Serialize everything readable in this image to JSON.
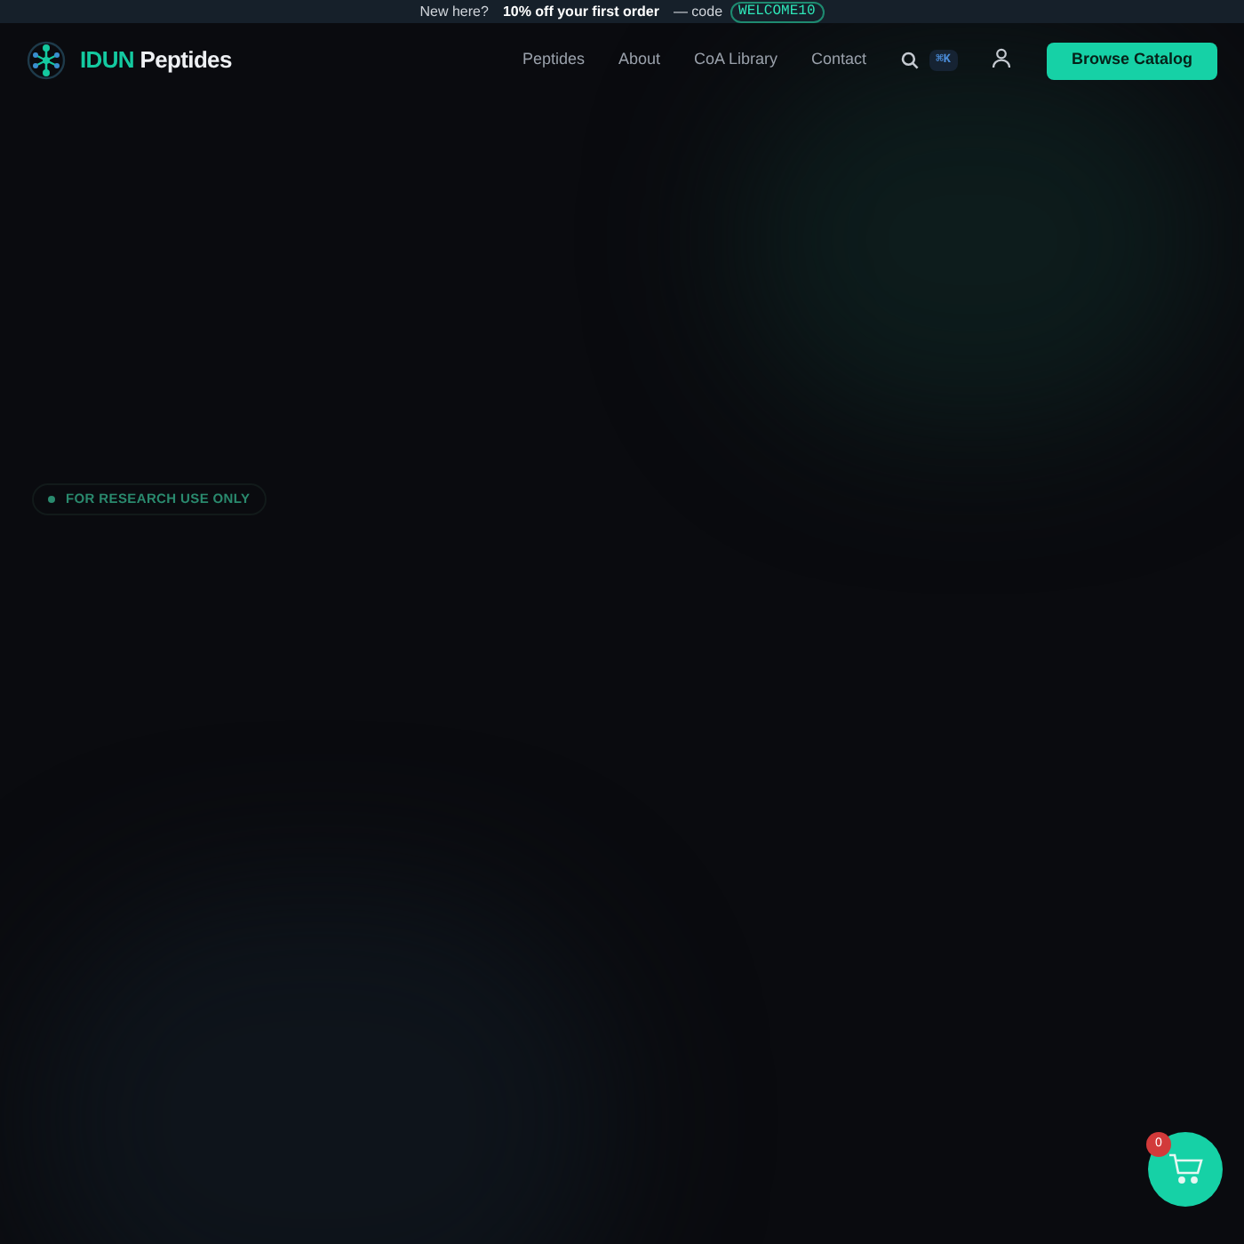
{
  "promo_bar": {
    "lead": "New here?",
    "offer": "10% off your first order",
    "code_label": "— code",
    "code": "WELCOME10"
  },
  "header": {
    "brand_accent": "IDUN",
    "brand_rest": "Peptides",
    "nav": [
      {
        "label": "Peptides"
      },
      {
        "label": "About"
      },
      {
        "label": "CoA Library"
      },
      {
        "label": "Contact"
      }
    ],
    "search_shortcut": "⌘K",
    "cta": "Browse Catalog"
  },
  "hero": {
    "badge": "FOR RESEARCH USE ONLY"
  },
  "cart": {
    "count": "0"
  }
}
